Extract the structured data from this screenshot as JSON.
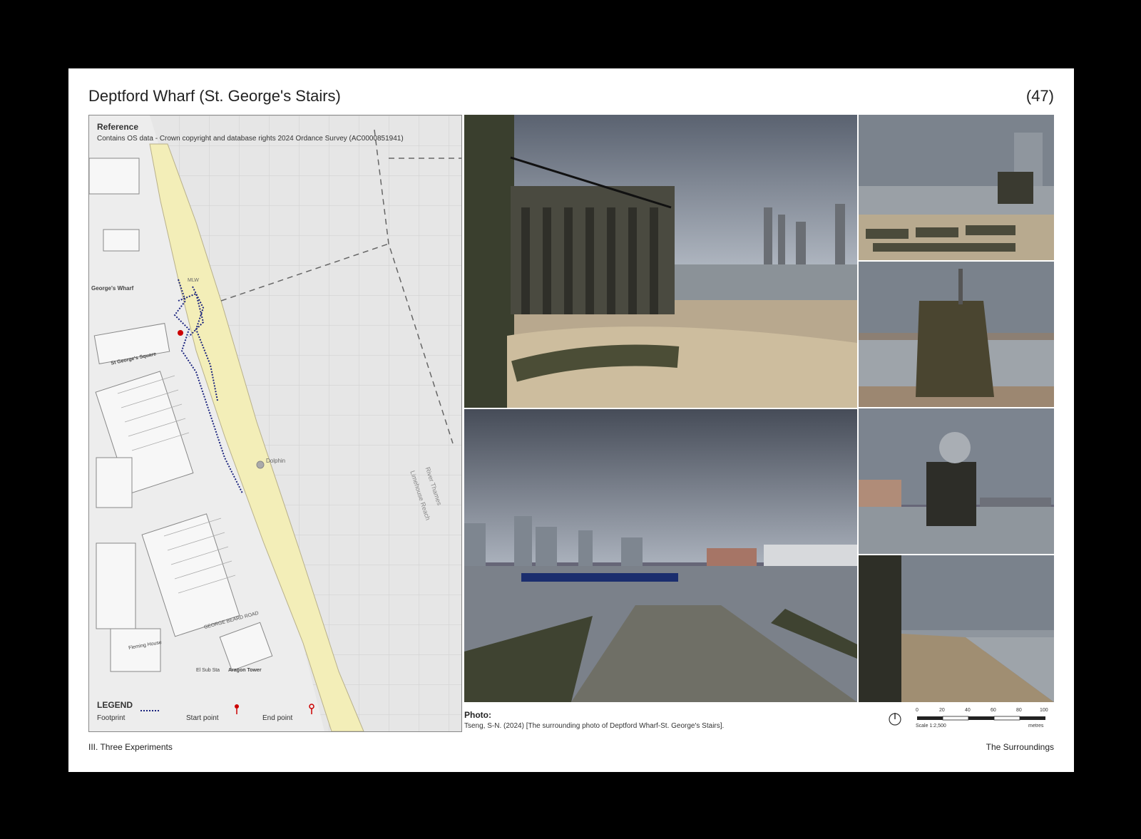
{
  "header": {
    "title": "Deptford Wharf (St. George's Stairs)",
    "page_number": "(47)"
  },
  "map": {
    "reference_title": "Reference",
    "reference_text": "Contains OS data - Crown copyright and database rights 2024 Ordance Survey (AC0000851941)",
    "labels": {
      "georges_wharf": "George's Wharf",
      "st_georges_square": "St George's Square",
      "dolphin": "Dolphin",
      "river_thames": "River Thames",
      "limehouse_reach": "Limehouse Reach",
      "aragon_tower": "Aragon Tower",
      "george_beard_road": "GEORGE BEARD ROAD",
      "mlw": "MLW",
      "el_sub_sta": "El Sub Sta",
      "fleming_house": "Fleming House"
    },
    "legend": {
      "title": "LEGEND",
      "footprint": "Footprint",
      "start_point": "Start point",
      "end_point": "End point"
    },
    "colors": {
      "foreshore": "#f3eeb8",
      "path": "#1a237e",
      "start": "#cc0000",
      "water": "#e6e6e6"
    }
  },
  "photos": {
    "items": [
      {
        "name": "photo-wharf-wall"
      },
      {
        "name": "photo-shore-ramp"
      },
      {
        "name": "photo-slipway-timbers"
      },
      {
        "name": "photo-dolphin-structure"
      },
      {
        "name": "photo-river-pier"
      },
      {
        "name": "photo-foreshore-wall"
      }
    ]
  },
  "credit": {
    "label": "Photo:",
    "text": "Tseng, S-N. (2024) [The surrounding photo of Deptford Wharf-St. George's Stairs]."
  },
  "scale": {
    "ticks": [
      "0",
      "20",
      "40",
      "60",
      "80",
      "100"
    ],
    "ratio": "Scale 1:2,500",
    "unit": "metres"
  },
  "footer": {
    "left": "III. Three Experiments",
    "right": "The Surroundings"
  }
}
